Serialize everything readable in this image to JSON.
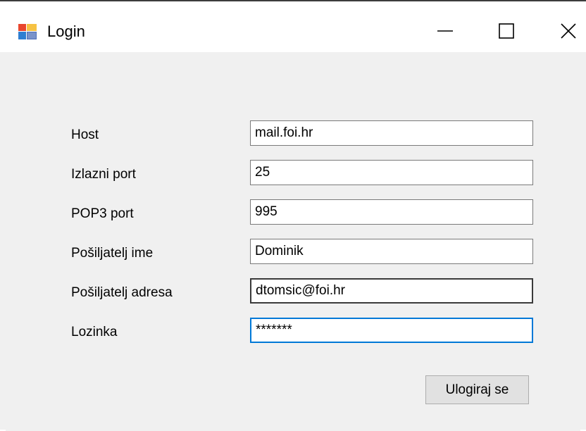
{
  "window": {
    "title": "Login",
    "icon": "windows-forms-app-icon",
    "controls": [
      "minimize-icon",
      "maximize-icon",
      "close-icon"
    ]
  },
  "form": {
    "fields": [
      {
        "label": "Host",
        "value": "mail.foi.hr"
      },
      {
        "label": "Izlazni port",
        "value": "25"
      },
      {
        "label": "POP3 port",
        "value": "995"
      },
      {
        "label": "Pošiljatelj ime",
        "value": "Dominik"
      },
      {
        "label": "Pošiljatelj adresa",
        "value": "dtomsic@foi.hr"
      },
      {
        "label": "Lozinka",
        "value": "*******"
      }
    ],
    "submit_label": "Ulogiraj se"
  },
  "colors": {
    "focus_border": "#0078d7",
    "window_bg": "#f0f0f0"
  }
}
